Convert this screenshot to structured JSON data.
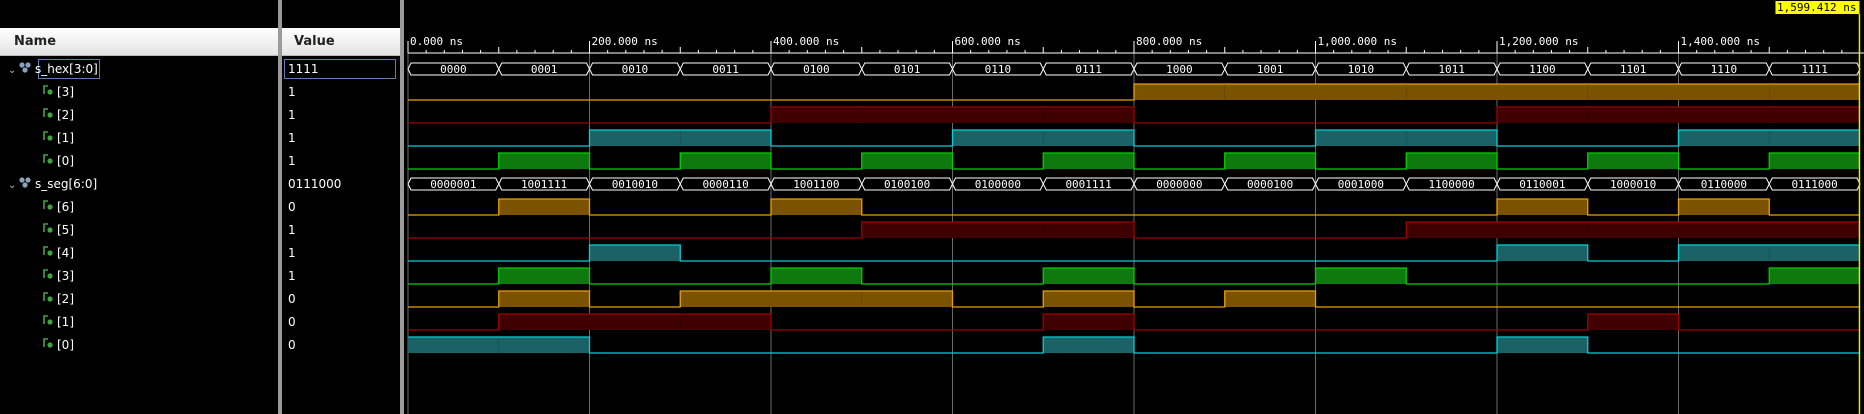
{
  "name_panel": {
    "header": "Name"
  },
  "value_panel": {
    "header": "Value"
  },
  "cursor_time": "1,599.412 ns",
  "timeline": {
    "tick_labels": [
      "0.000 ns",
      "200.000 ns",
      "400.000 ns",
      "600.000 ns",
      "800.000 ns",
      "1,000.000 ns",
      "1,200.000 ns",
      "1,400.000 ns"
    ],
    "major_ns": [
      0,
      200,
      400,
      600,
      800,
      1000,
      1200,
      1400
    ],
    "max_ns": 1599.412
  },
  "signals": [
    {
      "name": "s_hex[3:0]",
      "value": "1111",
      "type": "bus",
      "expanded": true,
      "level": 0,
      "selected": true,
      "segments": [
        "0000",
        "0001",
        "0010",
        "0011",
        "0100",
        "0101",
        "0110",
        "0111",
        "1000",
        "1001",
        "1010",
        "1011",
        "1100",
        "1101",
        "1110",
        "1111"
      ]
    },
    {
      "name": "[3]",
      "value": "1",
      "type": "bit",
      "level": 1,
      "color": "#e8a000",
      "fill": "#7a5200",
      "bits": "0000000011111111"
    },
    {
      "name": "[2]",
      "value": "1",
      "type": "bit",
      "level": 1,
      "color": "#a00000",
      "fill": "#3e0000",
      "bits": "0000111100001111"
    },
    {
      "name": "[1]",
      "value": "1",
      "type": "bit",
      "level": 1,
      "color": "#00d0d8",
      "fill": "#1a6266",
      "bits": "0011001100110011"
    },
    {
      "name": "[0]",
      "value": "1",
      "type": "bit",
      "level": 1,
      "color": "#00d000",
      "fill": "#0e7a0e",
      "bits": "0101010101010101"
    },
    {
      "name": "s_seg[6:0]",
      "value": "0111000",
      "type": "bus",
      "expanded": true,
      "level": 0,
      "selected": false,
      "segments": [
        "0000001",
        "1001111",
        "0010010",
        "0000110",
        "1001100",
        "0100100",
        "0100000",
        "0001111",
        "0000000",
        "0000100",
        "0001000",
        "1100000",
        "0110001",
        "1000010",
        "0110000",
        "0111000"
      ]
    },
    {
      "name": "[6]",
      "value": "0",
      "type": "bit",
      "level": 1,
      "color": "#e8a000",
      "fill": "#7a5200",
      "bits": "0100100000001010"
    },
    {
      "name": "[5]",
      "value": "1",
      "type": "bit",
      "level": 1,
      "color": "#a00000",
      "fill": "#3e0000",
      "bits": "0000011100011111"
    },
    {
      "name": "[4]",
      "value": "1",
      "type": "bit",
      "level": 1,
      "color": "#00d0d8",
      "fill": "#1a6266",
      "bits": "0010000000001011"
    },
    {
      "name": "[3]",
      "value": "1",
      "type": "bit",
      "level": 1,
      "color": "#00d000",
      "fill": "#0e7a0e",
      "bits": "0100100100100001"
    },
    {
      "name": "[2]",
      "value": "0",
      "type": "bit",
      "level": 1,
      "color": "#e8a000",
      "fill": "#7a5200",
      "bits": "0101110101000000"
    },
    {
      "name": "[1]",
      "value": "0",
      "type": "bit",
      "level": 1,
      "color": "#a00000",
      "fill": "#3e0000",
      "bits": "0111000100000100"
    },
    {
      "name": "[0]",
      "value": "0",
      "type": "bit",
      "level": 1,
      "color": "#00d0d8",
      "fill": "#1a6266",
      "bits": "1100000100001000"
    }
  ]
}
